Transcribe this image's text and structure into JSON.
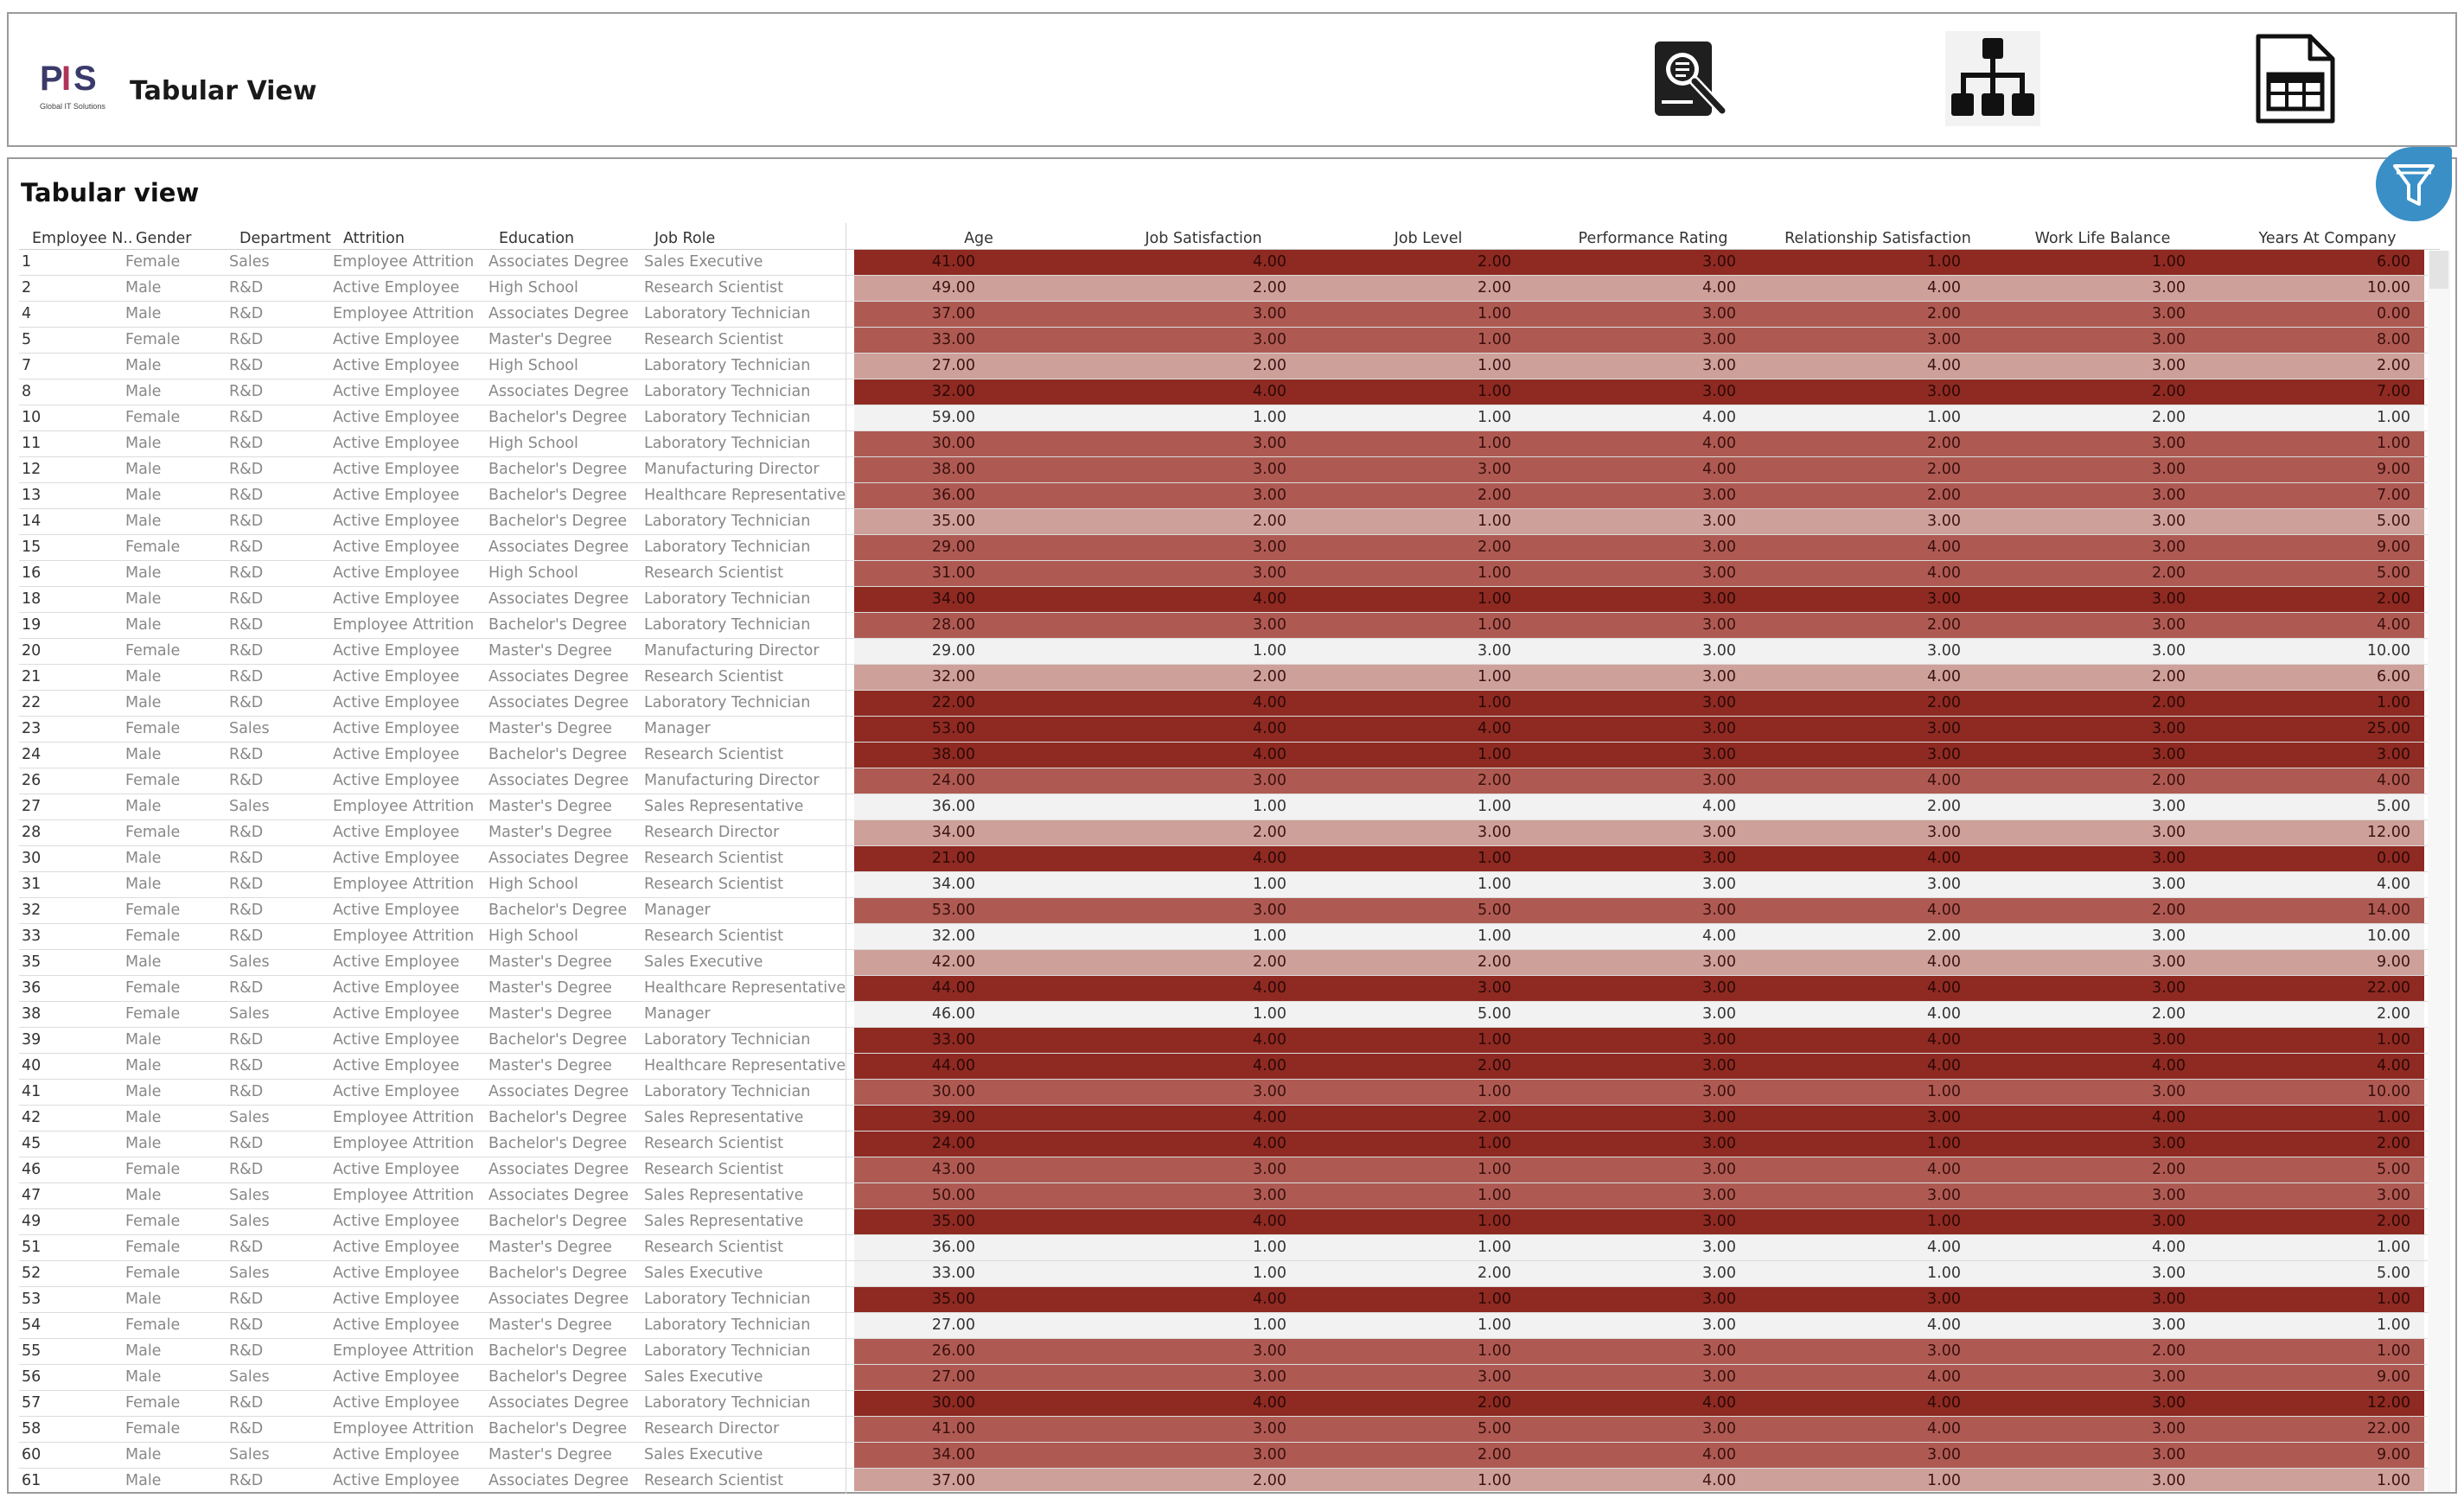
{
  "header": {
    "title": "Tabular View",
    "logo_text": "PIS",
    "logo_caption": "Global IT Solutions",
    "nav_icons": [
      "search-report-icon",
      "hierarchy-icon",
      "table-sheet-icon"
    ]
  },
  "panel": {
    "title": "Tabular view",
    "filter_icon": "funnel-icon"
  },
  "colors": {
    "scale_low": "#f2f2f2",
    "scale_mid_low": "#cea09a",
    "scale_mid_high": "#ae5a53",
    "scale_high": "#8e2a22",
    "filter_button": "#3a8fc7"
  },
  "columns": [
    "Employee N..",
    "Gender",
    "Department",
    "Attrition",
    "Education",
    "Job Role",
    "Age",
    "Job Satisfaction",
    "Job Level",
    "Performance Rating",
    "Relationship Satisfaction",
    "Work Life Balance",
    "Years At Company"
  ],
  "rows": [
    [
      "1",
      "Female",
      "Sales",
      "Employee Attrition",
      "Associates Degree",
      "Sales Executive",
      "41.00",
      "4.00",
      "2.00",
      "3.00",
      "1.00",
      "1.00",
      "6.00"
    ],
    [
      "2",
      "Male",
      "R&D",
      "Active Employee",
      "High School",
      "Research Scientist",
      "49.00",
      "2.00",
      "2.00",
      "4.00",
      "4.00",
      "3.00",
      "10.00"
    ],
    [
      "4",
      "Male",
      "R&D",
      "Employee Attrition",
      "Associates Degree",
      "Laboratory Technician",
      "37.00",
      "3.00",
      "1.00",
      "3.00",
      "2.00",
      "3.00",
      "0.00"
    ],
    [
      "5",
      "Female",
      "R&D",
      "Active Employee",
      "Master's Degree",
      "Research Scientist",
      "33.00",
      "3.00",
      "1.00",
      "3.00",
      "3.00",
      "3.00",
      "8.00"
    ],
    [
      "7",
      "Male",
      "R&D",
      "Active Employee",
      "High School",
      "Laboratory Technician",
      "27.00",
      "2.00",
      "1.00",
      "3.00",
      "4.00",
      "3.00",
      "2.00"
    ],
    [
      "8",
      "Male",
      "R&D",
      "Active Employee",
      "Associates Degree",
      "Laboratory Technician",
      "32.00",
      "4.00",
      "1.00",
      "3.00",
      "3.00",
      "2.00",
      "7.00"
    ],
    [
      "10",
      "Female",
      "R&D",
      "Active Employee",
      "Bachelor's Degree",
      "Laboratory Technician",
      "59.00",
      "1.00",
      "1.00",
      "4.00",
      "1.00",
      "2.00",
      "1.00"
    ],
    [
      "11",
      "Male",
      "R&D",
      "Active Employee",
      "High School",
      "Laboratory Technician",
      "30.00",
      "3.00",
      "1.00",
      "4.00",
      "2.00",
      "3.00",
      "1.00"
    ],
    [
      "12",
      "Male",
      "R&D",
      "Active Employee",
      "Bachelor's Degree",
      "Manufacturing Director",
      "38.00",
      "3.00",
      "3.00",
      "4.00",
      "2.00",
      "3.00",
      "9.00"
    ],
    [
      "13",
      "Male",
      "R&D",
      "Active Employee",
      "Bachelor's Degree",
      "Healthcare Representative",
      "36.00",
      "3.00",
      "2.00",
      "3.00",
      "2.00",
      "3.00",
      "7.00"
    ],
    [
      "14",
      "Male",
      "R&D",
      "Active Employee",
      "Bachelor's Degree",
      "Laboratory Technician",
      "35.00",
      "2.00",
      "1.00",
      "3.00",
      "3.00",
      "3.00",
      "5.00"
    ],
    [
      "15",
      "Female",
      "R&D",
      "Active Employee",
      "Associates Degree",
      "Laboratory Technician",
      "29.00",
      "3.00",
      "2.00",
      "3.00",
      "4.00",
      "3.00",
      "9.00"
    ],
    [
      "16",
      "Male",
      "R&D",
      "Active Employee",
      "High School",
      "Research Scientist",
      "31.00",
      "3.00",
      "1.00",
      "3.00",
      "4.00",
      "2.00",
      "5.00"
    ],
    [
      "18",
      "Male",
      "R&D",
      "Active Employee",
      "Associates Degree",
      "Laboratory Technician",
      "34.00",
      "4.00",
      "1.00",
      "3.00",
      "3.00",
      "3.00",
      "2.00"
    ],
    [
      "19",
      "Male",
      "R&D",
      "Employee Attrition",
      "Bachelor's Degree",
      "Laboratory Technician",
      "28.00",
      "3.00",
      "1.00",
      "3.00",
      "2.00",
      "3.00",
      "4.00"
    ],
    [
      "20",
      "Female",
      "R&D",
      "Active Employee",
      "Master's Degree",
      "Manufacturing Director",
      "29.00",
      "1.00",
      "3.00",
      "3.00",
      "3.00",
      "3.00",
      "10.00"
    ],
    [
      "21",
      "Male",
      "R&D",
      "Active Employee",
      "Associates Degree",
      "Research Scientist",
      "32.00",
      "2.00",
      "1.00",
      "3.00",
      "4.00",
      "2.00",
      "6.00"
    ],
    [
      "22",
      "Male",
      "R&D",
      "Active Employee",
      "Associates Degree",
      "Laboratory Technician",
      "22.00",
      "4.00",
      "1.00",
      "3.00",
      "2.00",
      "2.00",
      "1.00"
    ],
    [
      "23",
      "Female",
      "Sales",
      "Active Employee",
      "Master's Degree",
      "Manager",
      "53.00",
      "4.00",
      "4.00",
      "3.00",
      "3.00",
      "3.00",
      "25.00"
    ],
    [
      "24",
      "Male",
      "R&D",
      "Active Employee",
      "Bachelor's Degree",
      "Research Scientist",
      "38.00",
      "4.00",
      "1.00",
      "3.00",
      "3.00",
      "3.00",
      "3.00"
    ],
    [
      "26",
      "Female",
      "R&D",
      "Active Employee",
      "Associates Degree",
      "Manufacturing Director",
      "24.00",
      "3.00",
      "2.00",
      "3.00",
      "4.00",
      "2.00",
      "4.00"
    ],
    [
      "27",
      "Male",
      "Sales",
      "Employee Attrition",
      "Master's Degree",
      "Sales Representative",
      "36.00",
      "1.00",
      "1.00",
      "4.00",
      "2.00",
      "3.00",
      "5.00"
    ],
    [
      "28",
      "Female",
      "R&D",
      "Active Employee",
      "Master's Degree",
      "Research Director",
      "34.00",
      "2.00",
      "3.00",
      "3.00",
      "3.00",
      "3.00",
      "12.00"
    ],
    [
      "30",
      "Male",
      "R&D",
      "Active Employee",
      "Associates Degree",
      "Research Scientist",
      "21.00",
      "4.00",
      "1.00",
      "3.00",
      "4.00",
      "3.00",
      "0.00"
    ],
    [
      "31",
      "Male",
      "R&D",
      "Employee Attrition",
      "High School",
      "Research Scientist",
      "34.00",
      "1.00",
      "1.00",
      "3.00",
      "3.00",
      "3.00",
      "4.00"
    ],
    [
      "32",
      "Female",
      "R&D",
      "Active Employee",
      "Bachelor's Degree",
      "Manager",
      "53.00",
      "3.00",
      "5.00",
      "3.00",
      "4.00",
      "2.00",
      "14.00"
    ],
    [
      "33",
      "Female",
      "R&D",
      "Employee Attrition",
      "High School",
      "Research Scientist",
      "32.00",
      "1.00",
      "1.00",
      "4.00",
      "2.00",
      "3.00",
      "10.00"
    ],
    [
      "35",
      "Male",
      "Sales",
      "Active Employee",
      "Master's Degree",
      "Sales Executive",
      "42.00",
      "2.00",
      "2.00",
      "3.00",
      "4.00",
      "3.00",
      "9.00"
    ],
    [
      "36",
      "Female",
      "R&D",
      "Active Employee",
      "Master's Degree",
      "Healthcare Representative",
      "44.00",
      "4.00",
      "3.00",
      "3.00",
      "4.00",
      "3.00",
      "22.00"
    ],
    [
      "38",
      "Female",
      "Sales",
      "Active Employee",
      "Master's Degree",
      "Manager",
      "46.00",
      "1.00",
      "5.00",
      "3.00",
      "4.00",
      "2.00",
      "2.00"
    ],
    [
      "39",
      "Male",
      "R&D",
      "Active Employee",
      "Bachelor's Degree",
      "Laboratory Technician",
      "33.00",
      "4.00",
      "1.00",
      "3.00",
      "4.00",
      "3.00",
      "1.00"
    ],
    [
      "40",
      "Male",
      "R&D",
      "Active Employee",
      "Master's Degree",
      "Healthcare Representative",
      "44.00",
      "4.00",
      "2.00",
      "3.00",
      "4.00",
      "4.00",
      "4.00"
    ],
    [
      "41",
      "Male",
      "R&D",
      "Active Employee",
      "Associates Degree",
      "Laboratory Technician",
      "30.00",
      "3.00",
      "1.00",
      "3.00",
      "1.00",
      "3.00",
      "10.00"
    ],
    [
      "42",
      "Male",
      "Sales",
      "Employee Attrition",
      "Bachelor's Degree",
      "Sales Representative",
      "39.00",
      "4.00",
      "2.00",
      "3.00",
      "3.00",
      "4.00",
      "1.00"
    ],
    [
      "45",
      "Male",
      "R&D",
      "Employee Attrition",
      "Bachelor's Degree",
      "Research Scientist",
      "24.00",
      "4.00",
      "1.00",
      "3.00",
      "1.00",
      "3.00",
      "2.00"
    ],
    [
      "46",
      "Female",
      "R&D",
      "Active Employee",
      "Associates Degree",
      "Research Scientist",
      "43.00",
      "3.00",
      "1.00",
      "3.00",
      "4.00",
      "2.00",
      "5.00"
    ],
    [
      "47",
      "Male",
      "Sales",
      "Employee Attrition",
      "Associates Degree",
      "Sales Representative",
      "50.00",
      "3.00",
      "1.00",
      "3.00",
      "3.00",
      "3.00",
      "3.00"
    ],
    [
      "49",
      "Female",
      "Sales",
      "Active Employee",
      "Bachelor's Degree",
      "Sales Representative",
      "35.00",
      "4.00",
      "1.00",
      "3.00",
      "1.00",
      "3.00",
      "2.00"
    ],
    [
      "51",
      "Female",
      "R&D",
      "Active Employee",
      "Master's Degree",
      "Research Scientist",
      "36.00",
      "1.00",
      "1.00",
      "3.00",
      "4.00",
      "4.00",
      "1.00"
    ],
    [
      "52",
      "Female",
      "Sales",
      "Active Employee",
      "Bachelor's Degree",
      "Sales Executive",
      "33.00",
      "1.00",
      "2.00",
      "3.00",
      "1.00",
      "3.00",
      "5.00"
    ],
    [
      "53",
      "Male",
      "R&D",
      "Active Employee",
      "Associates Degree",
      "Laboratory Technician",
      "35.00",
      "4.00",
      "1.00",
      "3.00",
      "3.00",
      "3.00",
      "1.00"
    ],
    [
      "54",
      "Female",
      "R&D",
      "Active Employee",
      "Master's Degree",
      "Laboratory Technician",
      "27.00",
      "1.00",
      "1.00",
      "3.00",
      "4.00",
      "3.00",
      "1.00"
    ],
    [
      "55",
      "Male",
      "R&D",
      "Employee Attrition",
      "Bachelor's Degree",
      "Laboratory Technician",
      "26.00",
      "3.00",
      "1.00",
      "3.00",
      "3.00",
      "2.00",
      "1.00"
    ],
    [
      "56",
      "Male",
      "Sales",
      "Active Employee",
      "Bachelor's Degree",
      "Sales Executive",
      "27.00",
      "3.00",
      "3.00",
      "3.00",
      "4.00",
      "3.00",
      "9.00"
    ],
    [
      "57",
      "Female",
      "R&D",
      "Active Employee",
      "Associates Degree",
      "Laboratory Technician",
      "30.00",
      "4.00",
      "2.00",
      "4.00",
      "4.00",
      "3.00",
      "12.00"
    ],
    [
      "58",
      "Female",
      "R&D",
      "Employee Attrition",
      "Bachelor's Degree",
      "Research Director",
      "41.00",
      "3.00",
      "5.00",
      "3.00",
      "4.00",
      "3.00",
      "22.00"
    ],
    [
      "60",
      "Male",
      "Sales",
      "Active Employee",
      "Master's Degree",
      "Sales Executive",
      "34.00",
      "3.00",
      "2.00",
      "4.00",
      "3.00",
      "3.00",
      "9.00"
    ],
    [
      "61",
      "Male",
      "R&D",
      "Active Employee",
      "Associates Degree",
      "Research Scientist",
      "37.00",
      "2.00",
      "1.00",
      "4.00",
      "1.00",
      "3.00",
      "1.00"
    ]
  ]
}
